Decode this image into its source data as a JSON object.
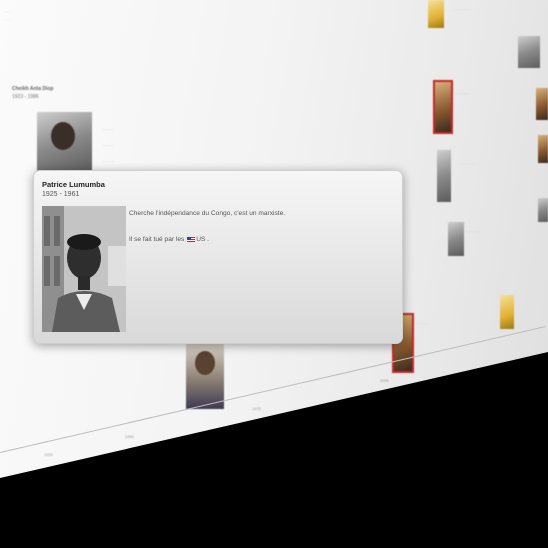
{
  "popup": {
    "name": "Patrice Lumumba",
    "years": "1925 - 1961",
    "line1": "Cherche l'indépendance du Congo, c'est un marxiste.",
    "line2_prefix": "Il se fait tué par les ",
    "line2_flag": "us-flag-icon",
    "line2_suffix": "US ."
  },
  "background_entries": {
    "header_name": "Cheikh Anta Diop",
    "header_years": "1923 - 1986"
  },
  "timeline": {
    "ticks": [
      "1925",
      "1950",
      "1975",
      "2000"
    ]
  },
  "colors": {
    "highlight_border": "#c62828"
  }
}
